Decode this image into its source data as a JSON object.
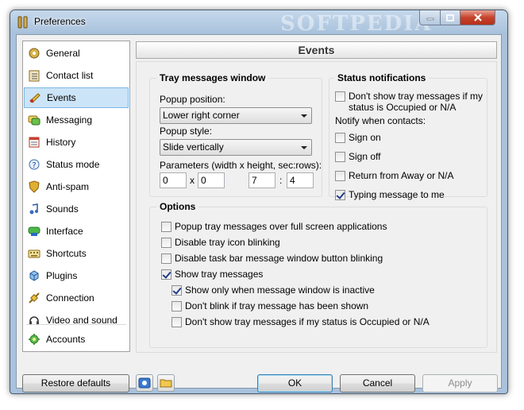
{
  "window": {
    "title": "Preferences",
    "watermark": "SOFTPEDIA"
  },
  "sidebar": {
    "items": [
      {
        "label": "General",
        "icon": "general-icon",
        "selected": false
      },
      {
        "label": "Contact list",
        "icon": "contact-list-icon",
        "selected": false
      },
      {
        "label": "Events",
        "icon": "events-icon",
        "selected": true
      },
      {
        "label": "Messaging",
        "icon": "messaging-icon",
        "selected": false
      },
      {
        "label": "History",
        "icon": "history-icon",
        "selected": false
      },
      {
        "label": "Status mode",
        "icon": "status-mode-icon",
        "selected": false
      },
      {
        "label": "Anti-spam",
        "icon": "anti-spam-icon",
        "selected": false
      },
      {
        "label": "Sounds",
        "icon": "sounds-icon",
        "selected": false
      },
      {
        "label": "Interface",
        "icon": "interface-icon",
        "selected": false
      },
      {
        "label": "Shortcuts",
        "icon": "shortcuts-icon",
        "selected": false
      },
      {
        "label": "Plugins",
        "icon": "plugins-icon",
        "selected": false
      },
      {
        "label": "Connection",
        "icon": "connection-icon",
        "selected": false
      },
      {
        "label": "Video and sound",
        "icon": "video-sound-icon",
        "selected": false
      },
      {
        "label": "Accounts",
        "icon": "accounts-icon",
        "selected": false
      }
    ]
  },
  "pane": {
    "header": "Events",
    "tray": {
      "title": "Tray messages window",
      "position_label": "Popup position:",
      "position_value": "Lower right corner",
      "style_label": "Popup style:",
      "style_value": "Slide vertically",
      "params_label": "Parameters (width x height, sec:rows):",
      "width": "0",
      "x_sep": "x",
      "height": "0",
      "seconds": "7",
      "colon_sep": ":",
      "rows": "4"
    },
    "status": {
      "title": "Status notifications",
      "dont_show_line1": "Don't show tray messages if my",
      "dont_show_line2": "status is Occupied or N/A",
      "dont_show_checked": false,
      "notify_label": "Notify when contacts:",
      "sign_on": "Sign on",
      "sign_on_checked": false,
      "sign_off": "Sign off",
      "sign_off_checked": false,
      "return_away": "Return from Away or N/A",
      "return_away_checked": false,
      "typing": "Typing message to me",
      "typing_checked": true
    },
    "options": {
      "title": "Options",
      "popup_fullscreen": "Popup tray messages over full screen applications",
      "disable_tray_blink": "Disable tray icon blinking",
      "disable_taskbar_blink": "Disable task bar message window button blinking",
      "show_tray": "Show tray messages",
      "show_only_inactive": "Show only when message window is inactive",
      "dont_blink_shown": "Don't blink if tray message has been shown",
      "dont_show_occupied": "Don't show tray messages if my status is Occupied or N/A"
    }
  },
  "footer": {
    "restore": "Restore defaults",
    "ok": "OK",
    "cancel": "Cancel",
    "apply": "Apply"
  }
}
